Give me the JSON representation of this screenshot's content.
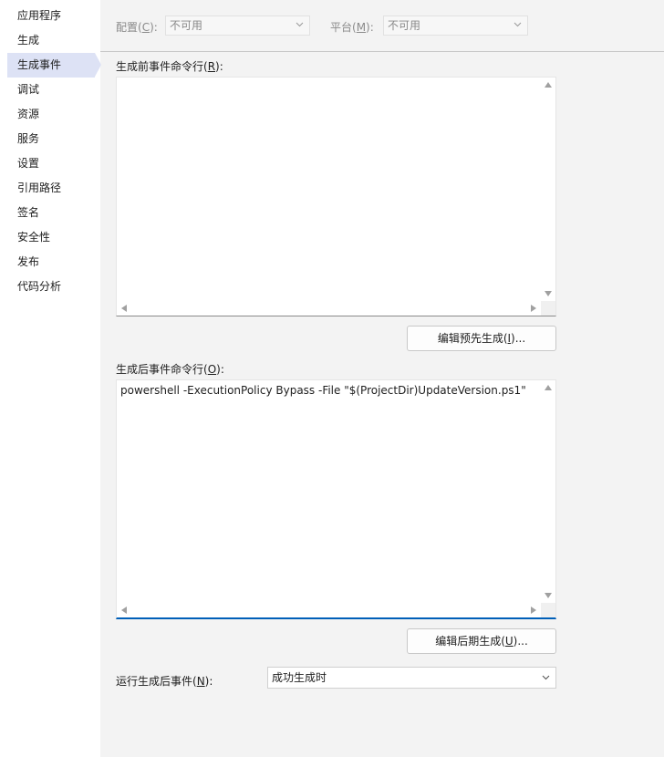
{
  "sidebar": {
    "items": [
      {
        "label": "应用程序"
      },
      {
        "label": "生成"
      },
      {
        "label": "生成事件"
      },
      {
        "label": "调试"
      },
      {
        "label": "资源"
      },
      {
        "label": "服务"
      },
      {
        "label": "设置"
      },
      {
        "label": "引用路径"
      },
      {
        "label": "签名"
      },
      {
        "label": "安全性"
      },
      {
        "label": "发布"
      },
      {
        "label": "代码分析"
      }
    ],
    "active_index": 2
  },
  "config": {
    "configuration_label": "配置(",
    "configuration_key": "C",
    "configuration_suffix": "):",
    "configuration_value": "不可用",
    "platform_label": "平台(",
    "platform_key": "M",
    "platform_suffix": "):",
    "platform_value": "不可用"
  },
  "prebuild": {
    "label": "生成前事件命令行(",
    "key": "R",
    "suffix": "):",
    "text": "",
    "edit_button_label": "编辑预先生成(",
    "edit_button_key": "I",
    "edit_button_suffix": ")..."
  },
  "postbuild": {
    "label": "生成后事件命令行(",
    "key": "O",
    "suffix": "):",
    "text": "powershell -ExecutionPolicy Bypass -File \"$(ProjectDir)UpdateVersion.ps1\"",
    "edit_button_label": "编辑后期生成(",
    "edit_button_key": "U",
    "edit_button_suffix": ")..."
  },
  "run_postbuild": {
    "label": "运行生成后事件(",
    "key": "N",
    "suffix": "):",
    "value": "成功生成时"
  },
  "colors": {
    "accent": "#005fb8",
    "active_nav": "#dde2f5"
  }
}
